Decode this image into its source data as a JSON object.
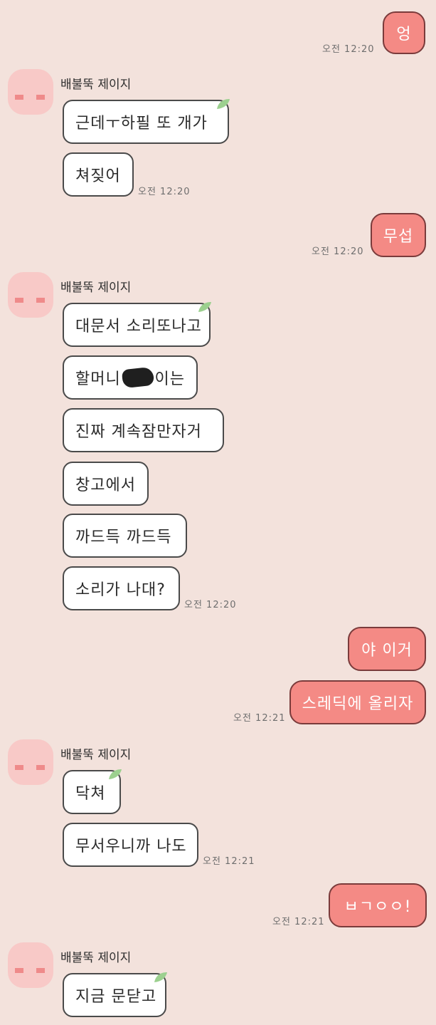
{
  "contact": {
    "name": "배불뚝 제이지"
  },
  "colors": {
    "background": "#f3e2dc",
    "outgoing_bubble": "#f48a85",
    "incoming_bubble": "#ffffff",
    "avatar": "#f8c9c7"
  },
  "messages": {
    "m1": {
      "text": "엉",
      "time": "오전 12:20"
    },
    "g1": {
      "b1": "근데ㅜ하필 또 개가",
      "b2": "쳐짖어",
      "time": "오전 12:20"
    },
    "m2": {
      "text": "무섭",
      "time": "오전 12:20"
    },
    "g2": {
      "b1": "대문서 소리또나고",
      "b2_pre": "할머니",
      "b2_post": "이는",
      "b3": "진짜 계속잠만자거",
      "b4": "창고에서",
      "b5": "까드득 까드득",
      "b6": "소리가 나대?",
      "time": "오전 12:20"
    },
    "m3": {
      "b1": "야 이거",
      "b2": "스레딕에 올리자",
      "time": "오전 12:21"
    },
    "g3": {
      "b1": "닥쳐",
      "b2": "무서우니까 나도",
      "time": "오전 12:21"
    },
    "m4": {
      "text": "ㅂㄱㅇㅇ!",
      "time": "오전 12:21"
    },
    "g4": {
      "b1": "지금 문닫고"
    }
  }
}
